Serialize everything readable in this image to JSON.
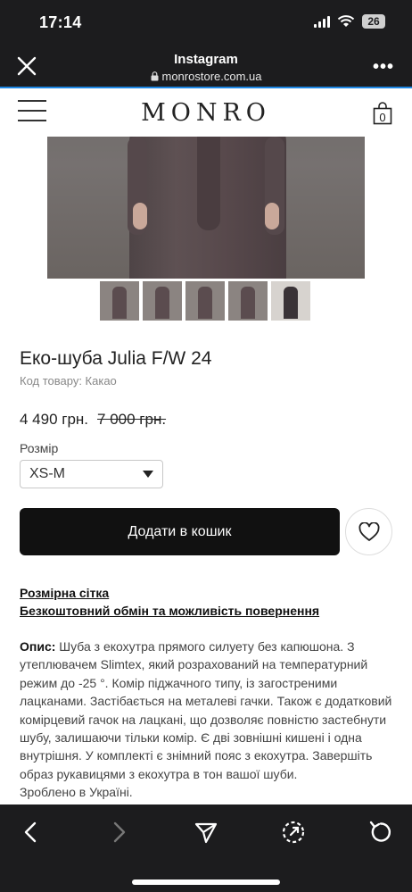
{
  "status_bar": {
    "time": "17:14",
    "battery": "26"
  },
  "ig_header": {
    "title": "Instagram",
    "url": "monrostore.com.ua"
  },
  "shop": {
    "brand": "MONRO",
    "cart_count": "0"
  },
  "product": {
    "title": "Еко-шуба Julia F/W 24",
    "sku": "Код товару: Какао",
    "price": "4 490 грн.",
    "old_price": "7 000 грн.",
    "size_label": "Розмір",
    "size_value": "XS-M",
    "add_to_cart": "Додати в кошик"
  },
  "links": {
    "size_chart": "Розмірна сітка",
    "exchange": "Безкоштовний обмін та можливість повернення"
  },
  "description": {
    "label": "Опис:",
    "text": " Шуба з екохутра прямого силуету без капюшона. З утеплювачем Slimtex, який розрахований на температурний режим до -25 °. Комір піджачного типу, із загостреними лацканами. Застібається на металеві гачки. Також є додатковий комірцевий гачок на лацкані, що дозволяє повністю застебнути шубу, залишаючи тільки комір. Є дві зовнішні кишені і одна внутрішня. У комплекті є знімний пояс з екохутра. Завершіть образ рукавицями з екохутра в тон вашої шуби.",
    "origin": "Зроблено в Україні."
  },
  "colors": {
    "accent": "#1e88e5",
    "chrome": "#1c1c1e",
    "button": "#111111"
  }
}
